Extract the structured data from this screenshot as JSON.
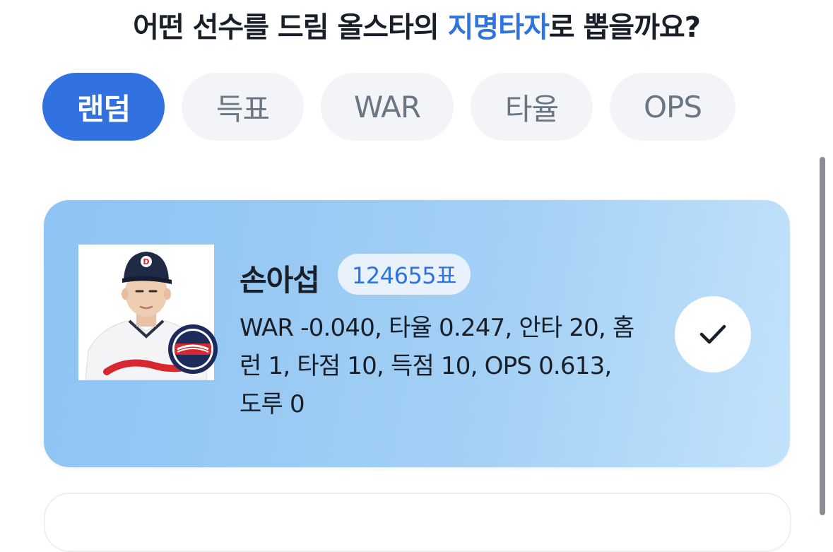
{
  "question": {
    "before": "어떤 선수를 드림 올스타의 ",
    "highlight": "지명타자",
    "after": "로 뽑을까요?",
    "highlight_color": "#2f73e0"
  },
  "tabs": [
    {
      "label": "랜덤",
      "active": true
    },
    {
      "label": "득표",
      "active": false
    },
    {
      "label": "WAR",
      "active": false
    },
    {
      "label": "타율",
      "active": false
    },
    {
      "label": "OPS",
      "active": false
    }
  ],
  "player_card": {
    "name": "손아섭",
    "votes": "124655표",
    "stats": "WAR -0.040, 타율 0.247, 안타 20, 홈런 1, 타점 10, 득점 10, OPS 0.613, 도루 0",
    "photo_icon": "player-photo",
    "team_logo": "bears-logo-icon",
    "selected": true
  },
  "colors": {
    "accent": "#3172e0",
    "tab_bg": "#f2f4f7",
    "tab_text": "#6b7684",
    "card_gradient_start": "#8ec3f3",
    "card_gradient_end": "#c2e2fb"
  }
}
